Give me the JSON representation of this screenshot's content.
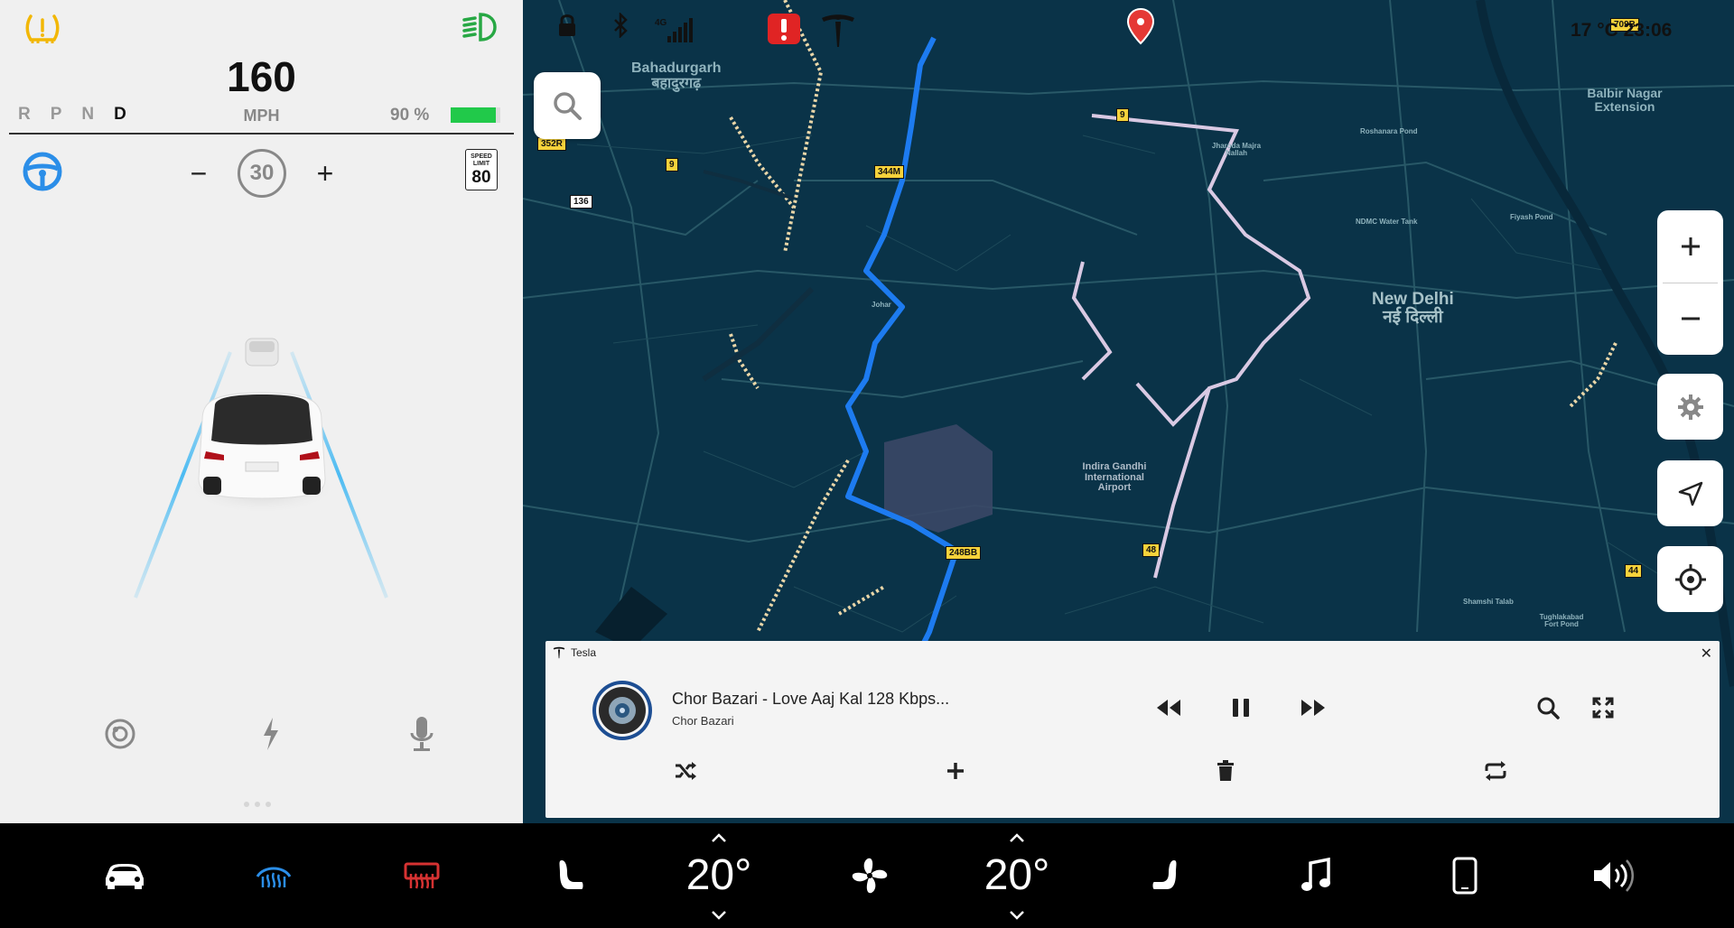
{
  "cluster": {
    "speed": "160",
    "gears": [
      "R",
      "P",
      "N",
      "D"
    ],
    "active_gear": "D",
    "unit": "MPH",
    "battery_percent": "90 %",
    "battery_level": 0.9,
    "cruise_minus": "−",
    "cruise_set": "30",
    "cruise_plus": "+",
    "speed_limit_label": "SPEED LIMIT",
    "speed_limit_value": "80"
  },
  "map": {
    "temperature_time": "17 °C  23:06",
    "labels": {
      "bahadurgarh": "Bahadurgarh",
      "bahadurgarh_hi": "बहादुरगढ़",
      "new_delhi": "New Delhi",
      "new_delhi_hi": "नई दिल्ली",
      "balbir": "Balbir Nagar Extension",
      "airport": "Indira Gandhi International Airport",
      "johar": "Johar",
      "roshanara": "Roshanara Pond",
      "ndmc": "NDMC Water Tank",
      "fiyash": "Fiyash Pond",
      "shamshi": "Shamshi Talab",
      "tughlakabad": "Tughlakabad Fort Pond",
      "jharoda": "Jharoda Majra Nallah"
    },
    "shields": [
      "352R",
      "9",
      "136",
      "344M",
      "9",
      "248BB",
      "48",
      "44",
      "709B"
    ],
    "icons": [
      "lock-icon",
      "bluetooth-icon",
      "signal-4g-icon",
      "alert-icon",
      "tesla-logo-icon"
    ],
    "signal_label": "4G"
  },
  "player": {
    "source": "Tesla",
    "title": "Chor Bazari - Love Aaj Kal 128 Kbps...",
    "artist": "Chor Bazari"
  },
  "dock": {
    "temp_left": "20°",
    "temp_right": "20°"
  },
  "colors": {
    "route_primary": "#1d7bf0",
    "route_alt": "#d9c9e3",
    "map_bg": "#0a3348",
    "battery": "#21c94a",
    "accent_blue": "#2b8ee8",
    "rear_defrost": "#d63232",
    "warning_yellow": "#f2b705"
  }
}
